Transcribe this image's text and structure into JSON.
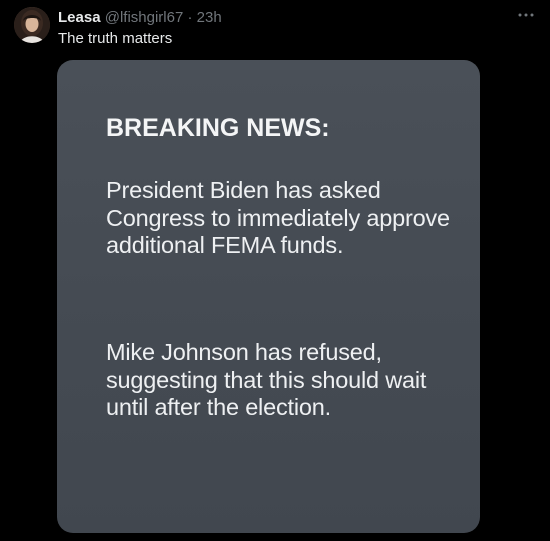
{
  "author": {
    "name": "Leasa",
    "handle": "@lfishgirl67",
    "separator": "·",
    "time": "23h"
  },
  "tweet": {
    "text": "The truth matters"
  },
  "more_icon": "more-horizontal-icon",
  "image_card": {
    "headline": "BREAKING NEWS:",
    "paragraph1": "President Biden has asked Congress to immediately approve additional FEMA funds.",
    "paragraph2": "Mike Johnson has refused, suggesting that this should wait until after the election."
  },
  "colors": {
    "background": "#000000",
    "text_primary": "#e7e9ea",
    "text_secondary": "#71767b",
    "card_background": "#464c54"
  }
}
